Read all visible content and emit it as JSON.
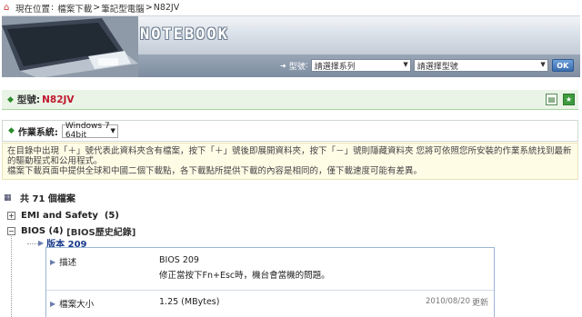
{
  "breadcrumb": {
    "prefix": "現在位置",
    "items": [
      "檔案下載",
      "筆記型電腦",
      "N82JV"
    ],
    "separator": ">"
  },
  "banner": {
    "title": "NOTEBOOK",
    "model_label": "型號",
    "series_select": "請選擇系列",
    "model_select": "請選擇型號",
    "ok_label": "OK"
  },
  "model": {
    "label": "型號:",
    "value": "N82JV"
  },
  "os": {
    "label": "作業系統:",
    "selected": "Windows 7 64bit"
  },
  "notice": {
    "line1": "在目錄中出現「＋」號代表此資料夾含有檔案，按下「＋」號後即展開資料夾，按下「－」號則隱藏資料夾 您將可依照您所安裝的作業系統找到最新的驅動程式和公用程式。",
    "line2": "檔案下載頁面中提供全球和中國二個下載點，各下載點所提供下載的內容是相同的，僅下載速度可能有差異。"
  },
  "files": {
    "count_text": "共 71 個檔案",
    "categories": [
      {
        "toggle": "+",
        "name": "EMI and Safety",
        "count": "(5)",
        "extra": ""
      },
      {
        "toggle": "−",
        "name": "BIOS",
        "count": "(4)",
        "extra": "[BIOS歷史紀錄]"
      }
    ],
    "version": "版本 209",
    "detail": {
      "desc_label": "描述",
      "desc_line1": "BIOS 209",
      "desc_line2": "修正當按下Fn+Esc時，機台會當機的問題。",
      "size_label": "檔案大小",
      "size_value": "1.25 (MBytes)",
      "date": "2010/08/20",
      "update_label": "更新"
    }
  },
  "colors": {
    "model_value": "#c0182e",
    "green_bar": "#e9f4e6",
    "notice_bg": "#fffce6"
  }
}
